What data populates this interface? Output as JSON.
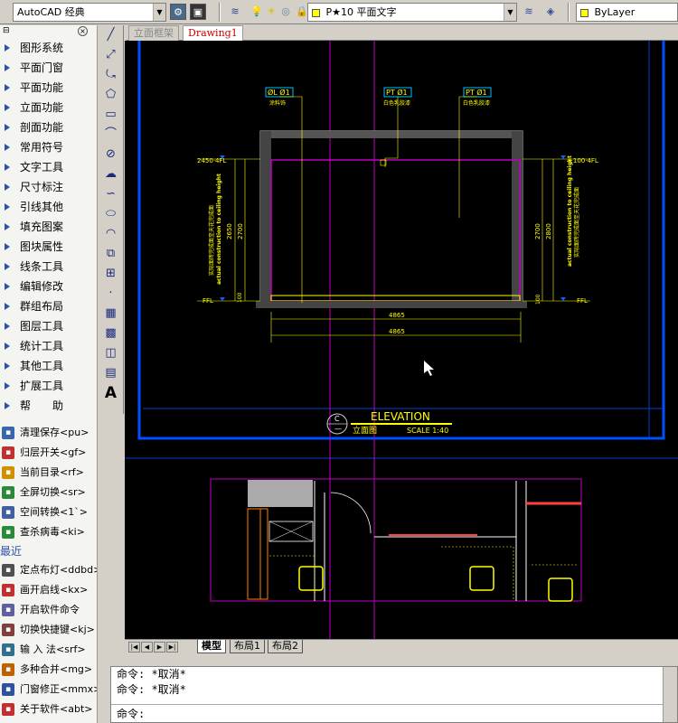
{
  "toolbar": {
    "workspace": "AutoCAD 经典",
    "layer": "P★10 平面文字",
    "color": "ByLayer"
  },
  "left_menu": {
    "items": [
      "图形系统",
      "平面门窗",
      "平面功能",
      "立面功能",
      "剖面功能",
      "常用符号",
      "文字工具",
      "尺寸标注",
      "引线其他",
      "填充图案",
      "图块属性",
      "线条工具",
      "编辑修改",
      "群组布局",
      "图层工具",
      "统计工具",
      "其他工具",
      "扩展工具",
      "帮　　助"
    ],
    "tools": [
      "清理保存<pu>",
      "归层开关<gf>",
      "当前目录<rf>",
      "全屏切换<sr>",
      "空间转换<1`>",
      "查杀病毒<ki>"
    ],
    "recent_label": "最近",
    "recent": [
      "定点布灯<ddbd>",
      "画开启线<kx>",
      "开启软件命令",
      "切换快捷键<kj>",
      "输 入 法<srf>",
      "多种合并<mg>",
      "门窗修正<mmx>",
      "关于软件<abt>"
    ]
  },
  "doc_tabs": [
    "立面框架",
    "Drawing1"
  ],
  "layout_tabs": [
    "模型",
    "布局1",
    "布局2"
  ],
  "drawing": {
    "title": "ELEVATION",
    "subtitle": "立面图",
    "scale": "SCALE 1:40",
    "marker_top": "C",
    "marker_bottom": "—",
    "dim_width_1": "4865",
    "dim_width_2": "4865",
    "dim_left_1": "2650",
    "dim_left_2": "2700",
    "dim_right_1": "2700",
    "dim_right_2": "2800",
    "tag_left": "ØL  Ø1",
    "tag_mid": "PT  Ø1",
    "tag_right": "PT  Ø1",
    "note_left": "涂料饰",
    "note_mid": "白色乳胶漆",
    "note_right": "白色乳胶漆",
    "level_left": "2450·4FL",
    "level_right": "±100·4FL",
    "fl_left": "FFL",
    "fl_right": "FFL",
    "vert_text_left": "实际面砖完成面至天花完成面",
    "vert_text_right": "actual construction to ceiling height",
    "dim_small_l": "100",
    "dim_small_r": "100"
  },
  "command": {
    "history": [
      "命令: *取消*",
      "命令: *取消*"
    ],
    "prompt": "命令:"
  }
}
